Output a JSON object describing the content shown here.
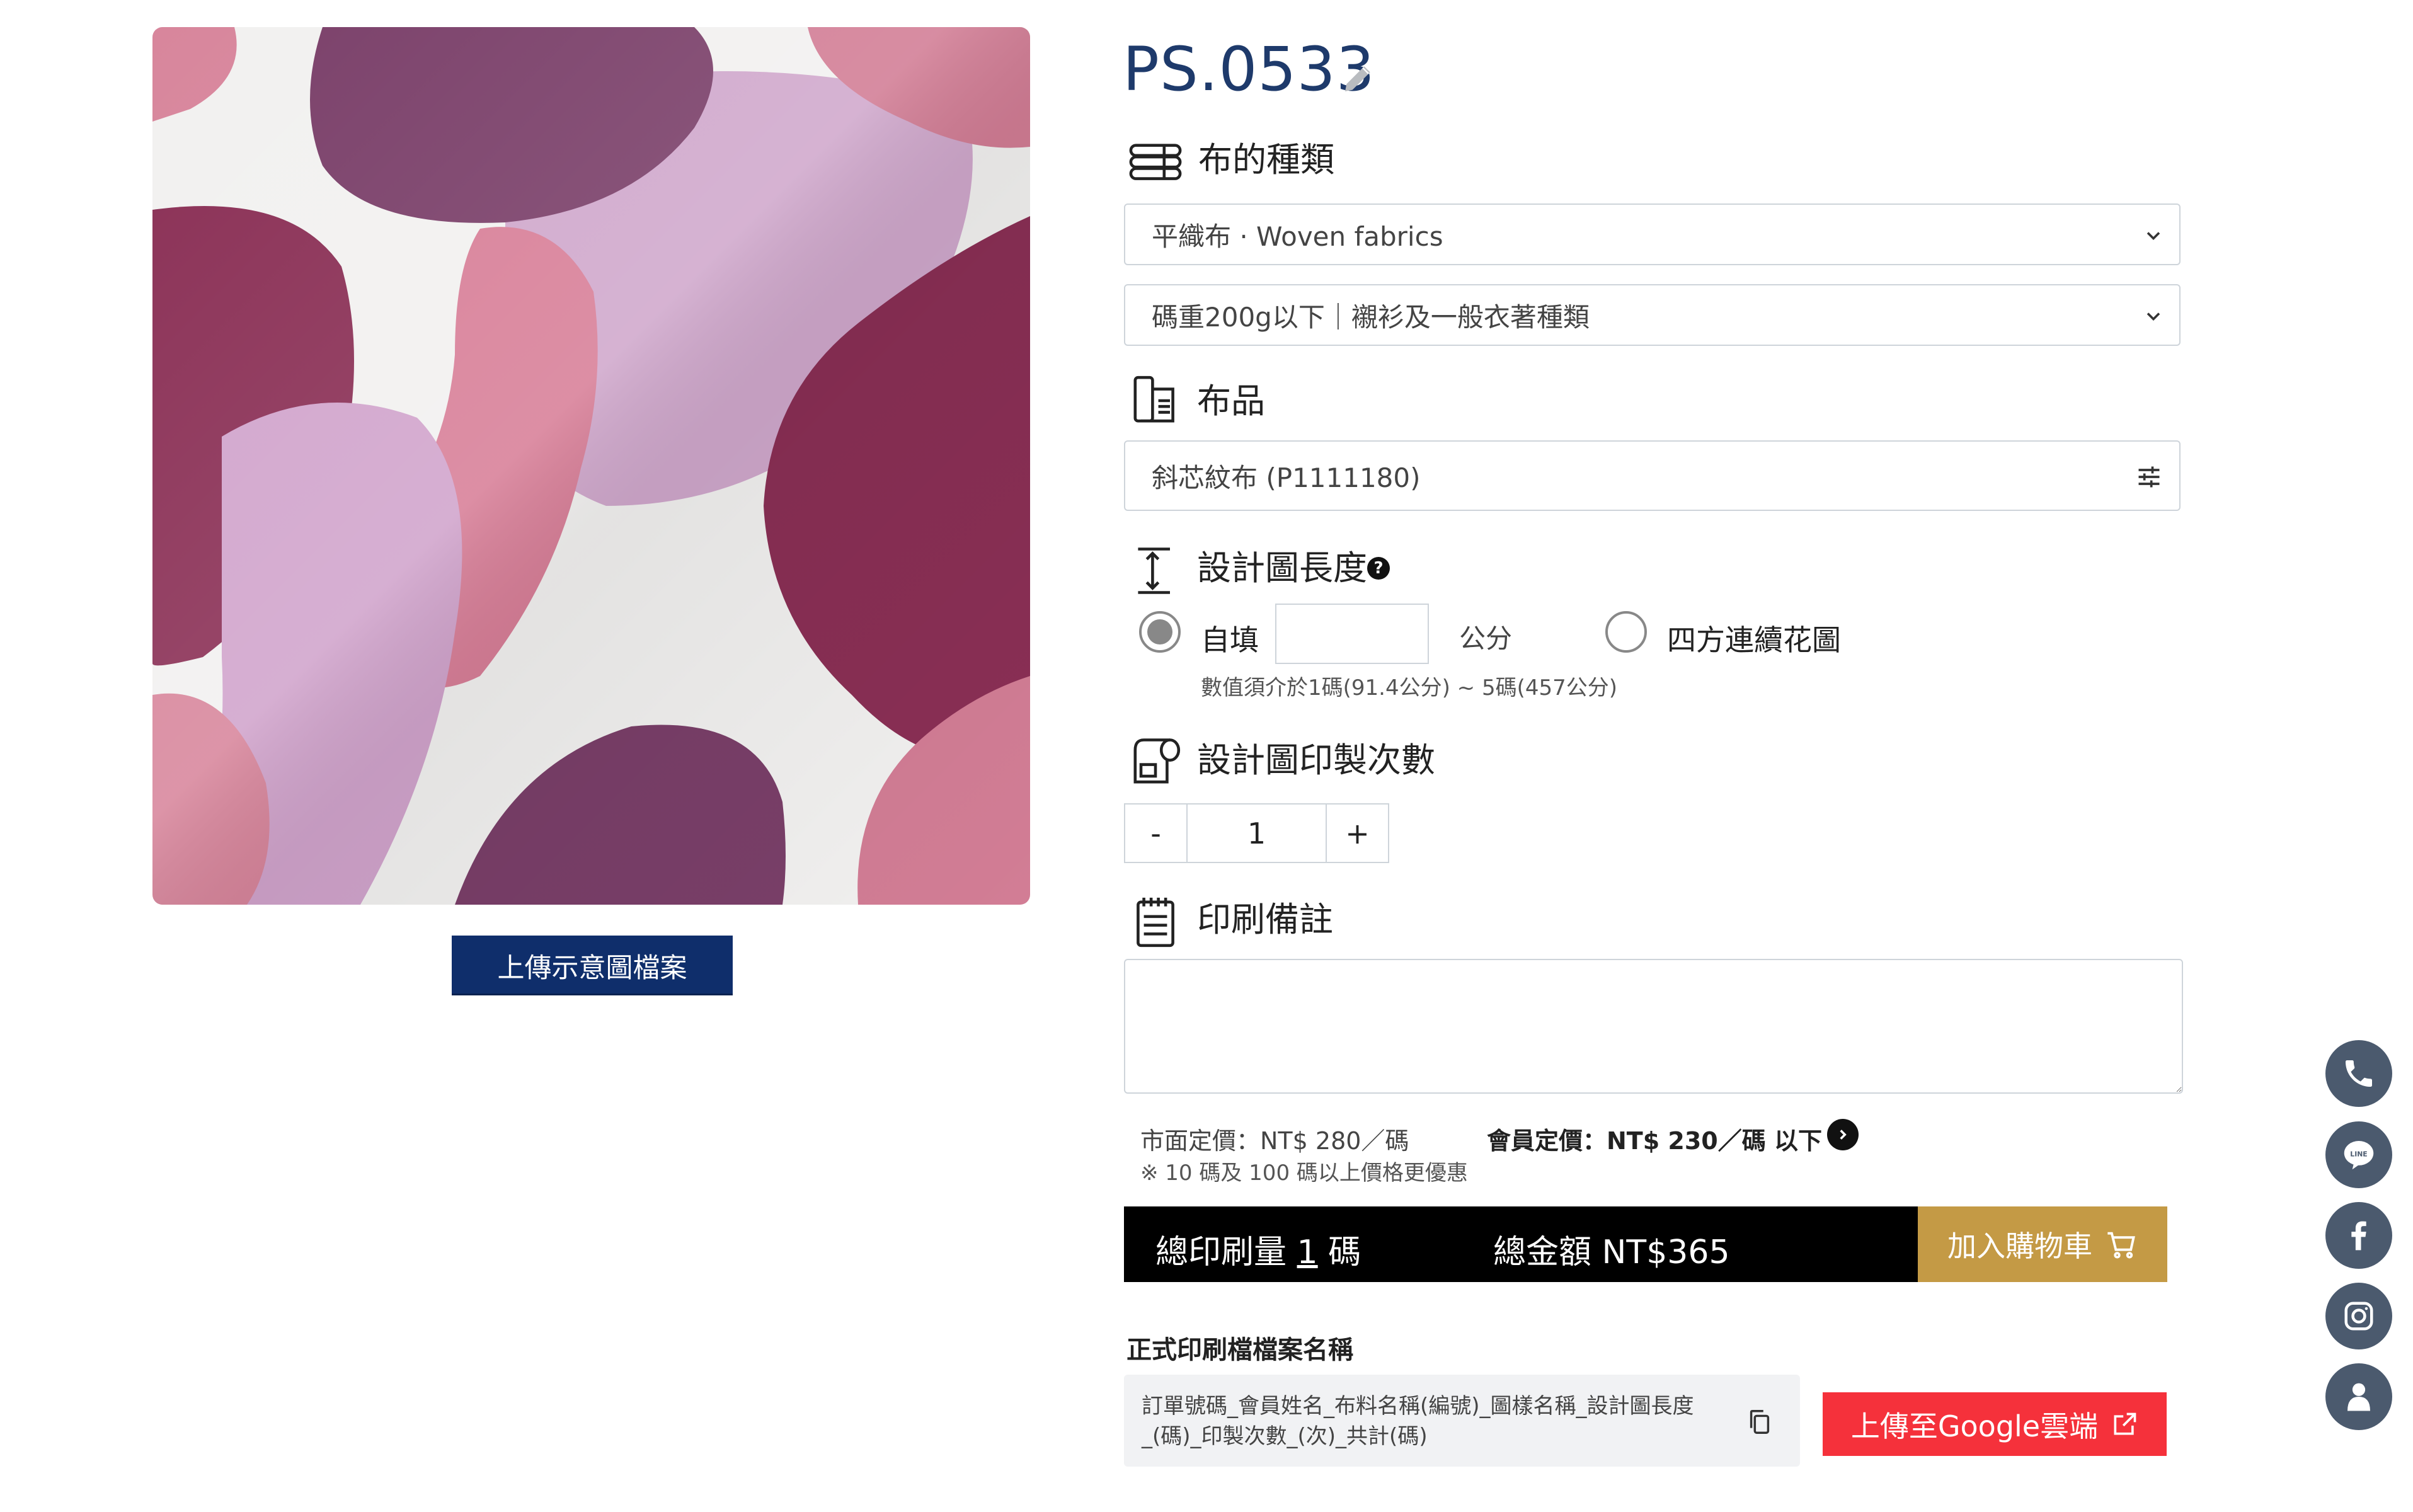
{
  "product": {
    "code": "PS.0533",
    "upload_sketch_label": "上傳示意圖檔案"
  },
  "fabric_type": {
    "title": "布的種類",
    "primary_selected": "平織布 · Woven fabrics",
    "weight_selected": "碼重200g以下｜襯衫及一般衣著種類"
  },
  "fabric": {
    "title": "布品",
    "selected": "斜芯紋布 (P1111180)"
  },
  "design_length": {
    "title": "設計圖長度",
    "help_glyph": "?",
    "custom_label": "自填",
    "custom_value": "",
    "unit": "公分",
    "repeat_label": "四方連續花圖",
    "hint": "數值須介於1碼(91.4公分) ~ 5碼(457公分)"
  },
  "print_count": {
    "title": "設計圖印製次數",
    "minus": "-",
    "value": "1",
    "plus": "+"
  },
  "notes": {
    "title": "印刷備註",
    "value": ""
  },
  "pricing": {
    "market_price": "市面定價：NT$ 280／碼",
    "member_price": "會員定價：NT$ 230／碼 以下",
    "discount_note": "※ 10 碼及 100 碼以上價格更優惠"
  },
  "summary": {
    "total_prefix": "總印刷量",
    "total_qty": "1",
    "total_unit": "碼",
    "total_amount": "總金額 NT$365",
    "add_to_cart": "加入購物車"
  },
  "filename": {
    "title": "正式印刷檔檔案名稱",
    "template": "訂單號碼_會員姓名_布料名稱(編號)_圖樣名稱_設計圖長度_(碼)_印製次數_(次)_共計(碼)",
    "upload_google": "上傳至Google雲端"
  },
  "floating_contacts": [
    "phone-icon",
    "line-icon",
    "facebook-icon",
    "instagram-icon",
    "user-icon"
  ],
  "colors": {
    "navy": "#0f2e6b",
    "title_blue": "#1e3a6b",
    "gold": "#c49a45",
    "red": "#f5313b",
    "float_gray": "#4b5a6e"
  }
}
